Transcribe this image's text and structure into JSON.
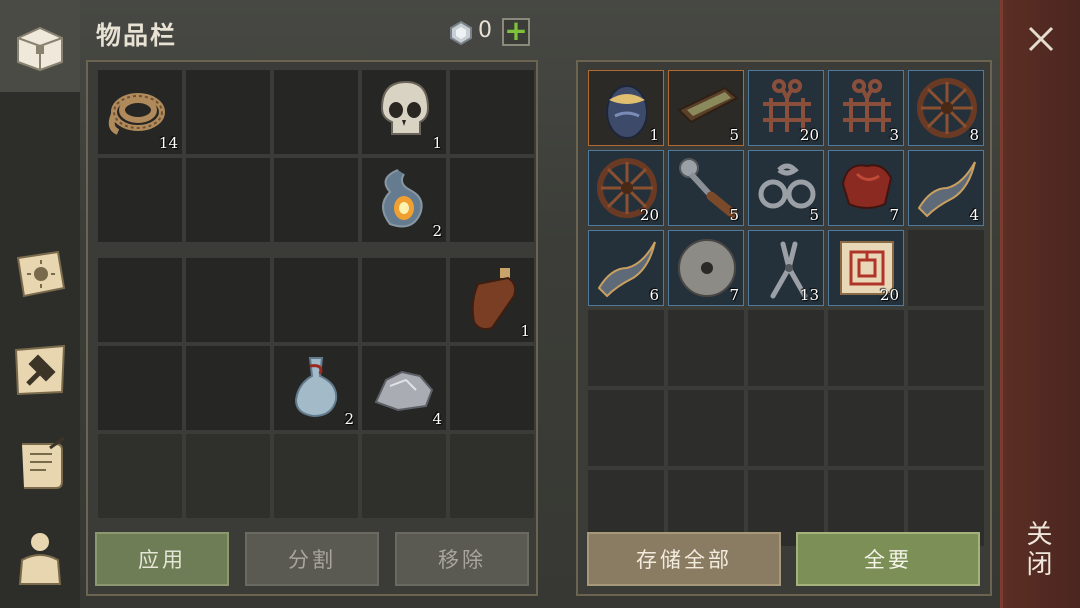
{
  "header": {
    "title": "物品栏",
    "gem_count": "0"
  },
  "left_inventory": {
    "pockets": [
      {
        "slot": 0,
        "item": "rope",
        "count": "14"
      },
      {
        "slot": 3,
        "item": "skull",
        "count": "1"
      },
      {
        "slot": 8,
        "item": "essence-wisp",
        "count": "2"
      }
    ],
    "bag": [
      {
        "slot": 4,
        "item": "leather-flask",
        "count": "1"
      },
      {
        "slot": 7,
        "item": "potion-bottle",
        "count": "2"
      },
      {
        "slot": 8,
        "item": "stone-ore",
        "count": "4"
      }
    ]
  },
  "left_buttons": {
    "apply": "应用",
    "split": "分割",
    "remove": "移除"
  },
  "storage": {
    "items": [
      {
        "item": "mystery-egg",
        "count": "1"
      },
      {
        "item": "wooden-tray",
        "count": "5"
      },
      {
        "item": "iron-rack",
        "count": "20"
      },
      {
        "item": "iron-rack",
        "count": "3"
      },
      {
        "item": "wagon-wheel",
        "count": "8"
      },
      {
        "item": "wagon-wheel",
        "count": "20"
      },
      {
        "item": "crank-handle",
        "count": "5"
      },
      {
        "item": "iron-shackles",
        "count": "5"
      },
      {
        "item": "saddle",
        "count": "7"
      },
      {
        "item": "bow-limb",
        "count": "4"
      },
      {
        "item": "bow-limb",
        "count": "6"
      },
      {
        "item": "grind-stone",
        "count": "7"
      },
      {
        "item": "pliers",
        "count": "13"
      },
      {
        "item": "map-scroll",
        "count": "20"
      }
    ]
  },
  "storage_buttons": {
    "store_all": "存储全部",
    "take_all": "全要"
  },
  "close": {
    "label": "关闭"
  },
  "colors": {
    "accent_green": "#7ec23a",
    "close_bar": "#5c2e24"
  }
}
